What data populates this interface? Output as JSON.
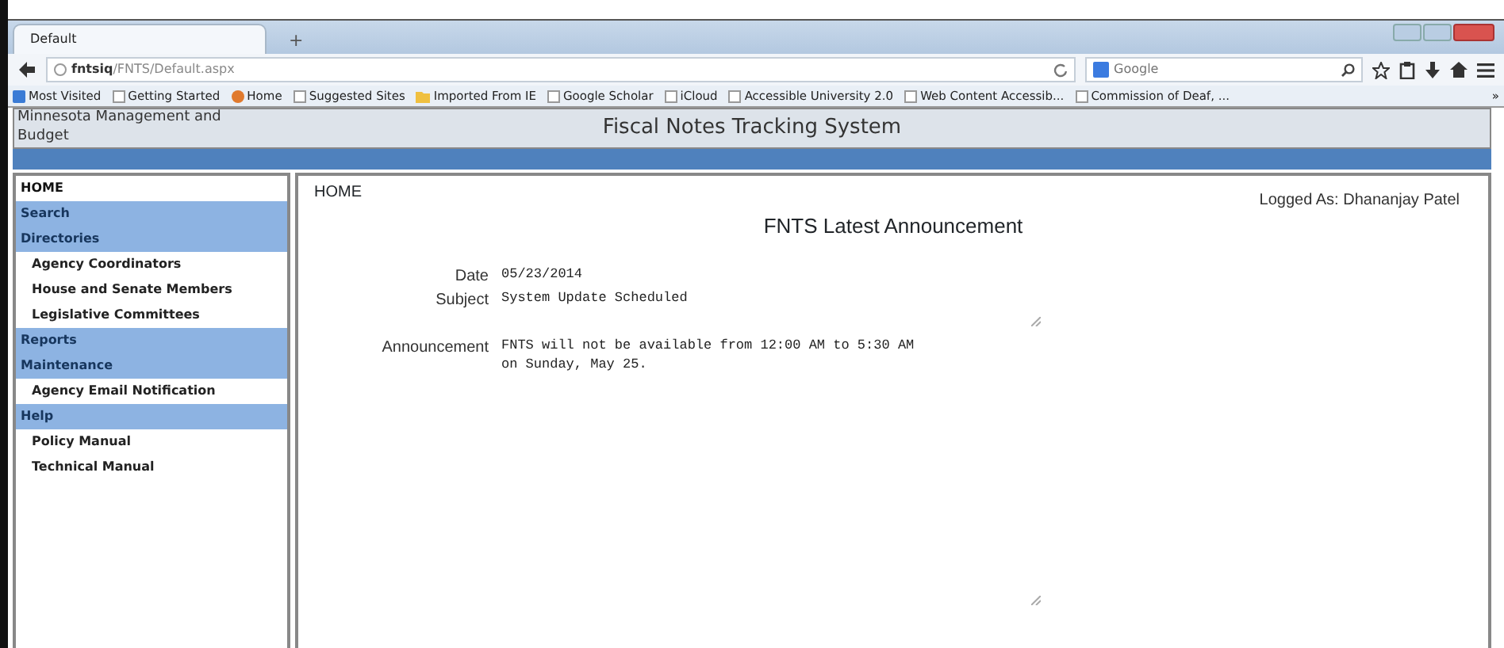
{
  "browser": {
    "tab": "Default",
    "new_tab": "+",
    "url_host": "fntsiq",
    "url_path": "/FNTS/Default.aspx",
    "search_placeholder": "Google",
    "bookmarks": [
      {
        "label": "Most Visited",
        "kind": "smart"
      },
      {
        "label": "Getting Started",
        "kind": "page"
      },
      {
        "label": "Home",
        "kind": "home"
      },
      {
        "label": "Suggested Sites",
        "kind": "page"
      },
      {
        "label": "Imported From IE",
        "kind": "folder"
      },
      {
        "label": "Google Scholar",
        "kind": "page"
      },
      {
        "label": "iCloud",
        "kind": "page"
      },
      {
        "label": "Accessible University 2.0",
        "kind": "page"
      },
      {
        "label": "Web Content Accessib...",
        "kind": "page"
      },
      {
        "label": "Commission of Deaf, ...",
        "kind": "page"
      }
    ],
    "overflow": "»"
  },
  "header": {
    "org": "Minnesota Management and Budget",
    "title": "Fiscal Notes Tracking System"
  },
  "sidebar": {
    "items": [
      {
        "label": "HOME",
        "kind": "top"
      },
      {
        "label": "Search",
        "kind": "section"
      },
      {
        "label": "Directories",
        "kind": "section"
      },
      {
        "label": "Agency Coordinators",
        "kind": "link"
      },
      {
        "label": "House and Senate Members",
        "kind": "link"
      },
      {
        "label": "Legislative Committees",
        "kind": "link"
      },
      {
        "label": "Reports",
        "kind": "section"
      },
      {
        "label": "Maintenance",
        "kind": "section"
      },
      {
        "label": "Agency Email Notification",
        "kind": "link"
      },
      {
        "label": "Help",
        "kind": "section"
      },
      {
        "label": "Policy Manual",
        "kind": "link"
      },
      {
        "label": "Technical Manual",
        "kind": "link"
      }
    ]
  },
  "main": {
    "breadcrumb": "HOME",
    "logged_as": "Logged As: Dhananjay Patel",
    "heading": "FNTS Latest Announcement",
    "fields": [
      {
        "label": "Date",
        "value": "05/23/2014",
        "kind": "text"
      },
      {
        "label": "Subject",
        "value": "System Update Scheduled",
        "kind": "textarea"
      },
      {
        "label": "Announcement",
        "value": "FNTS will not be available from 12:00 AM to 5:30 AM\non Sunday, May 25.",
        "kind": "bigarea"
      }
    ]
  }
}
